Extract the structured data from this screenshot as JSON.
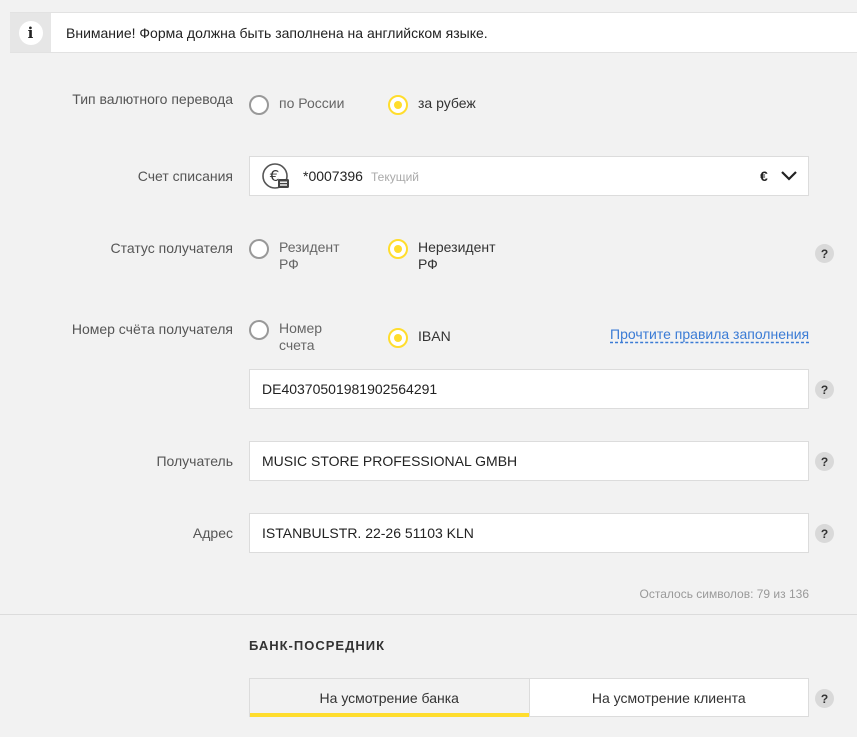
{
  "notice": {
    "text": "Внимание! Форма должна быть заполнена на английском языке."
  },
  "transfer_type": {
    "label": "Тип валютного перевода",
    "options": [
      "по России",
      "за рубеж"
    ],
    "selected": "за рубеж"
  },
  "debit_account": {
    "label": "Счет списания",
    "number": "*0007396",
    "type": "Текущий",
    "currency": "€",
    "icon": "euro-card-icon"
  },
  "recipient_status": {
    "label": "Статус получателя",
    "options": [
      {
        "line1": "Резидент",
        "line2": "РФ"
      },
      {
        "line1": "Нерезидент",
        "line2": "РФ"
      }
    ],
    "selected": "Нерезидент"
  },
  "recipient_account": {
    "label": "Номер счёта получателя",
    "options": [
      {
        "line1": "Номер",
        "line2": "счета"
      },
      {
        "line1": "IBAN",
        "line2": ""
      }
    ],
    "selected": "IBAN",
    "rules_link": "Прочтите правила заполнения",
    "value": "DE40370501981902564291"
  },
  "recipient": {
    "label": "Получатель",
    "value": "MUSIC STORE PROFESSIONAL GMBH"
  },
  "address": {
    "label": "Адрес",
    "value": "ISTANBULSTR. 22-26 51103 KLN",
    "counter": "Осталось символов: 79 из 136"
  },
  "intermediary_bank": {
    "title": "БАНК-ПОСРЕДНИК",
    "options": [
      "На усмотрение банка",
      "На усмотрение клиента"
    ],
    "selected": "На усмотрение банка"
  },
  "help_symbol": "?",
  "colors": {
    "accent": "#ffdd2d",
    "link": "#3a7bd5",
    "background": "#f2f2f2"
  }
}
